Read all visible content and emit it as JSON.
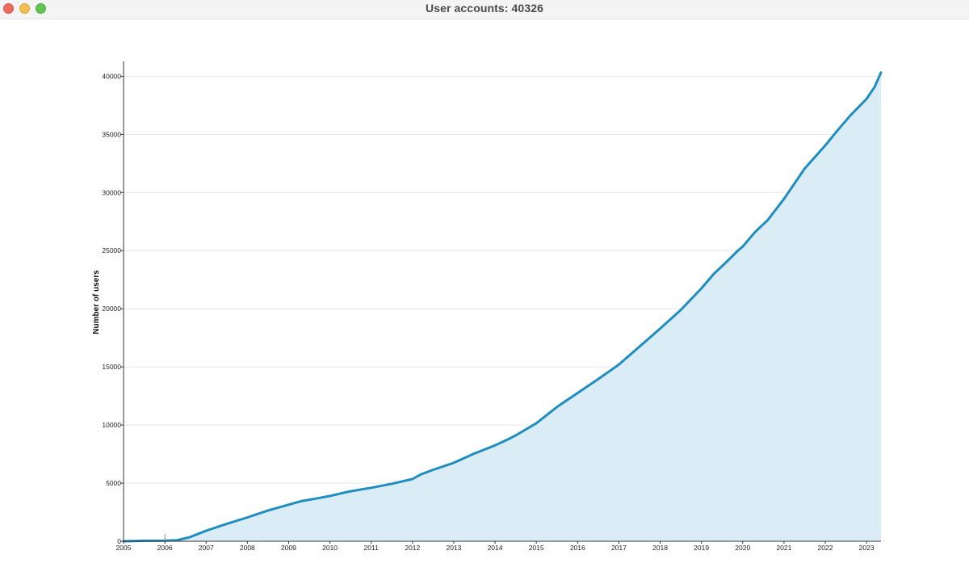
{
  "window": {
    "title": "User accounts: 40326"
  },
  "colors": {
    "line": "#1f8dc0",
    "fill": "#daedf7",
    "grid": "#e6e6e6",
    "axis": "#333333"
  },
  "chart_data": {
    "type": "area",
    "title": "",
    "xlabel": "",
    "ylabel": "Number of users",
    "xlim": [
      2005,
      2023.35
    ],
    "ylim": [
      0,
      41000
    ],
    "grid": "horizontal",
    "legend": "none",
    "x_ticks": [
      2005,
      2006,
      2007,
      2008,
      2009,
      2010,
      2011,
      2012,
      2013,
      2014,
      2015,
      2016,
      2017,
      2018,
      2019,
      2020,
      2021,
      2022,
      2023
    ],
    "x_tick_labels": [
      "2005",
      "2006",
      "2007",
      "2008",
      "2009",
      "2010",
      "2011",
      "2012",
      "2013",
      "2014",
      "2015",
      "2016",
      "2017",
      "2018",
      "2019",
      "2020",
      "2021",
      "2022",
      "2023"
    ],
    "y_ticks": [
      0,
      5000,
      10000,
      15000,
      20000,
      25000,
      30000,
      35000,
      40000
    ],
    "y_tick_labels": [
      "0",
      "5000",
      "10000",
      "15000",
      "20000",
      "25000",
      "30000",
      "35000",
      "40000"
    ],
    "x": [
      2005.0,
      2005.5,
      2006.0,
      2006.3,
      2006.6,
      2007.0,
      2007.5,
      2008.0,
      2008.5,
      2009.0,
      2009.3,
      2009.7,
      2010.0,
      2010.3,
      2010.5,
      2011.0,
      2011.5,
      2012.0,
      2012.2,
      2012.5,
      2013.0,
      2013.5,
      2014.0,
      2014.3,
      2014.5,
      2015.0,
      2015.5,
      2016.0,
      2016.5,
      2017.0,
      2017.5,
      2018.0,
      2018.5,
      2019.0,
      2019.3,
      2019.6,
      2019.9,
      2020.0,
      2020.3,
      2020.6,
      2021.0,
      2021.5,
      2022.0,
      2022.3,
      2022.6,
      2023.0,
      2023.2,
      2023.35
    ],
    "y": [
      0,
      40,
      50,
      90,
      350,
      900,
      1500,
      2050,
      2650,
      3150,
      3450,
      3700,
      3900,
      4150,
      4300,
      4600,
      4950,
      5350,
      5750,
      6150,
      6750,
      7550,
      8250,
      8750,
      9100,
      10150,
      11550,
      12750,
      13950,
      15200,
      16750,
      18300,
      19900,
      21750,
      23000,
      24000,
      25050,
      25350,
      26600,
      27600,
      29450,
      32050,
      34050,
      35350,
      36600,
      38050,
      39100,
      40326
    ]
  }
}
